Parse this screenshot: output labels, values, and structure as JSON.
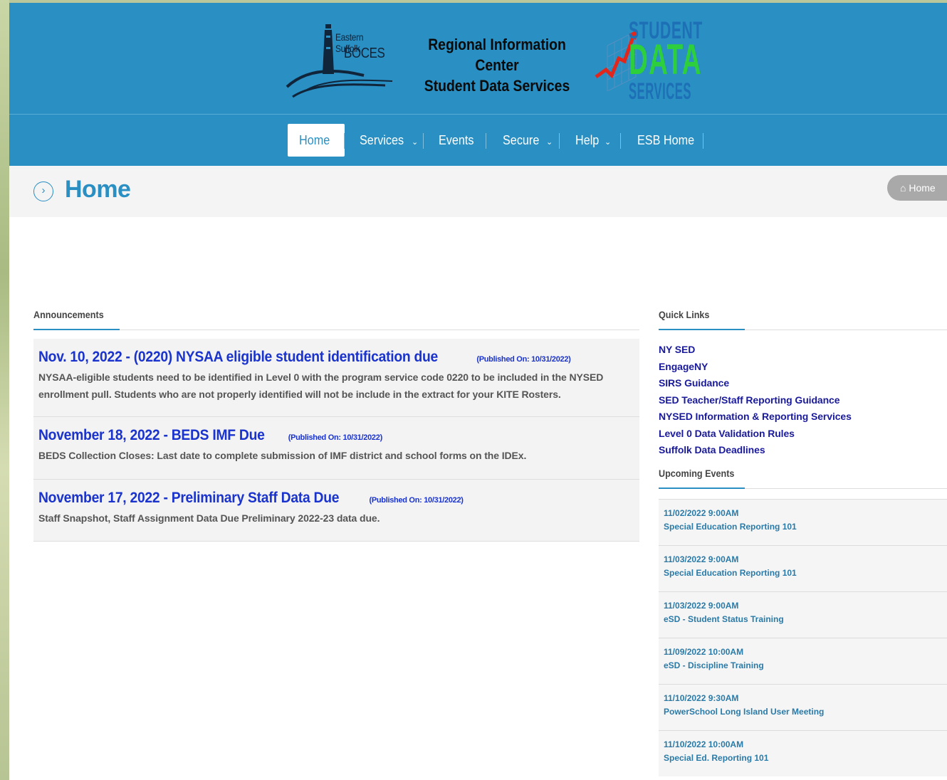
{
  "header": {
    "boces_line1": "Eastern Suffolk",
    "boces_line2": "BOCES",
    "title_line1": "Regional Information Center",
    "title_line2": "Student Data Services",
    "logo_word1": "STUDENT",
    "logo_word2": "DATA",
    "logo_word3": "SERVICES"
  },
  "nav": {
    "items": [
      {
        "label": "Home"
      },
      {
        "label": "Services",
        "chevron": "⌄"
      },
      {
        "label": "Events"
      },
      {
        "label": "Secure",
        "chevron": "⌄"
      },
      {
        "label": "Help",
        "chevron": "⌄"
      },
      {
        "label": "ESB Home"
      }
    ]
  },
  "page": {
    "title": "Home",
    "breadcrumb": "Home"
  },
  "announcements": {
    "heading": "Announcements",
    "items": [
      {
        "title": "Nov. 10, 2022 - (0220) NYSAA eligible student identification due",
        "published": "(Published On: 10/31/2022)",
        "body": "NYSAA-eligible students need to be identified in Level 0 with the program service code 0220 to be included in the NYSED enrollment pull. Students who are not properly identified will not be include in the extract for your KITE Rosters."
      },
      {
        "title": "November 18, 2022 - BEDS IMF Due",
        "published": "(Published On: 10/31/2022)",
        "body": "BEDS Collection Closes: Last date to complete submission of IMF district and school forms on the IDEx."
      },
      {
        "title": "November 17, 2022 - Preliminary Staff Data Due",
        "published": "(Published On: 10/31/2022)",
        "body": "Staff Snapshot, Staff Assignment Data Due Preliminary 2022-23 data due."
      }
    ]
  },
  "quick_links": {
    "heading": "Quick Links",
    "items": [
      "NY SED",
      "EngageNY",
      "SIRS Guidance",
      "SED Teacher/Staff Reporting Guidance",
      "NYSED Information & Reporting Services",
      "Level 0 Data Validation Rules",
      "Suffolk Data Deadlines"
    ]
  },
  "upcoming_events": {
    "heading": "Upcoming Events",
    "items": [
      {
        "date": "11/02/2022 9:00AM",
        "title": "Special Education Reporting 101"
      },
      {
        "date": "11/03/2022 9:00AM",
        "title": "Special Education Reporting 101"
      },
      {
        "date": "11/03/2022 9:00AM",
        "title": "eSD - Student Status Training"
      },
      {
        "date": "11/09/2022 10:00AM",
        "title": "eSD - Discipline Training"
      },
      {
        "date": "11/10/2022 9:30AM",
        "title": "PowerSchool Long Island User Meeting"
      },
      {
        "date": "11/10/2022 10:00AM",
        "title": "Special Ed. Reporting 101"
      }
    ]
  },
  "colors": {
    "header_blue": "#2a8fc2",
    "link_blue": "#1a33cc",
    "event_blue": "#2a7aa8",
    "data_green": "#2dcf3c"
  },
  "icons": {
    "title_marker": "chevron-right-circle-icon",
    "breadcrumb": "home-icon",
    "nav_dropdown": "chevron-down-icon"
  }
}
